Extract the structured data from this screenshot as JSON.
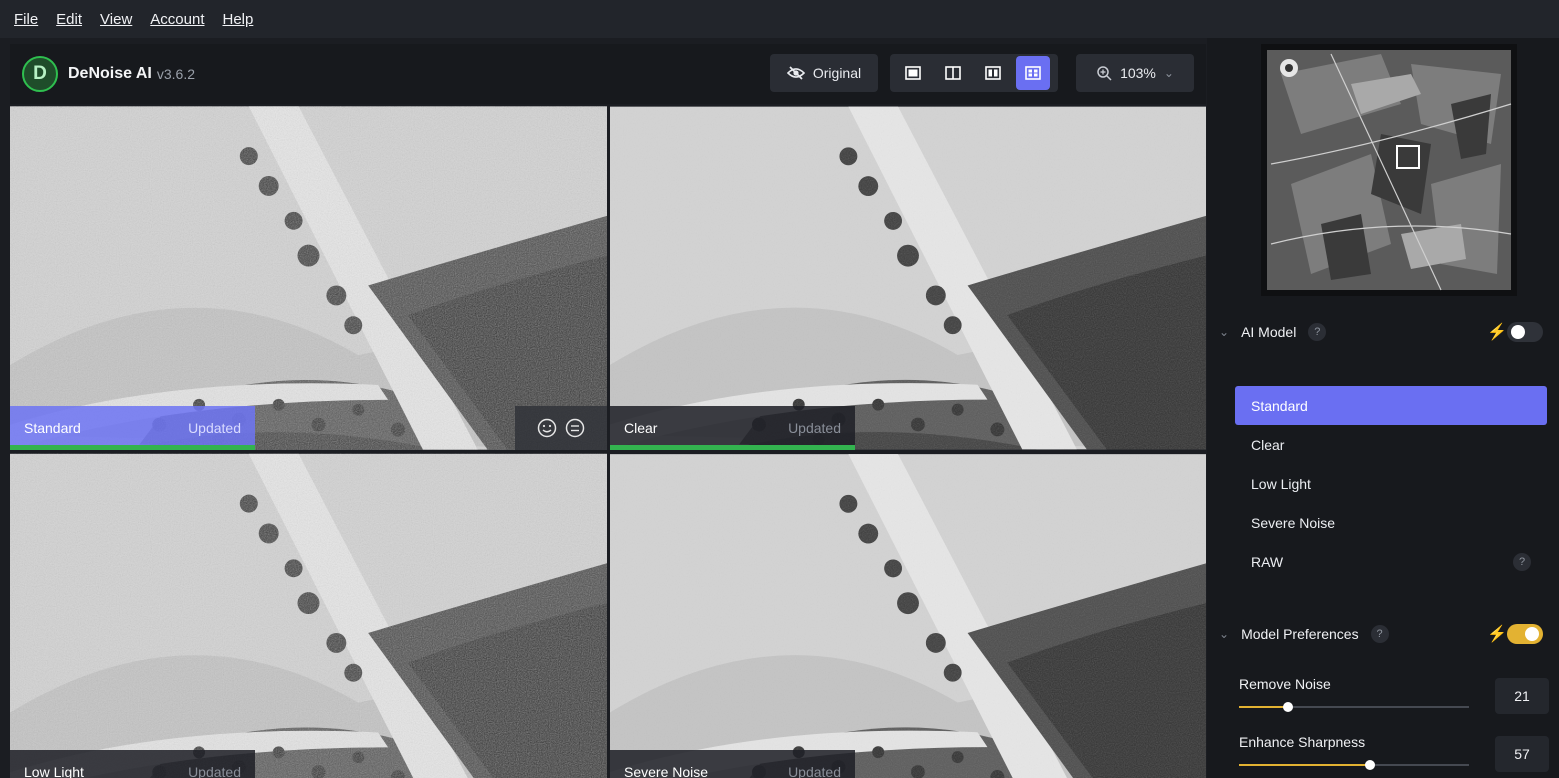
{
  "menu": [
    "File",
    "Edit",
    "View",
    "Account",
    "Help"
  ],
  "app": {
    "name": "DeNoise AI",
    "version": "v3.6.2",
    "logo_letter": "D"
  },
  "toolbar": {
    "original_label": "Original",
    "view_modes": [
      "single-view",
      "split-view",
      "side-by-side-view",
      "comparison-grid-view"
    ],
    "active_view": "comparison-grid-view",
    "zoom": "103%"
  },
  "panes": [
    {
      "name": "Standard",
      "status": "Updated",
      "selected": true,
      "progress": 1.0
    },
    {
      "name": "Clear",
      "status": "Updated",
      "selected": false,
      "progress": 1.0
    },
    {
      "name": "Low Light",
      "status": "Updated",
      "selected": false,
      "progress": 0
    },
    {
      "name": "Severe Noise",
      "status": "Updated",
      "selected": false,
      "progress": 0
    }
  ],
  "sidebar": {
    "ai_model": {
      "title": "AI Model",
      "help": "?",
      "auto_enabled": false,
      "items": [
        {
          "label": "Standard",
          "selected": true
        },
        {
          "label": "Clear",
          "selected": false
        },
        {
          "label": "Low Light",
          "selected": false
        },
        {
          "label": "Severe Noise",
          "selected": false
        },
        {
          "label": "RAW",
          "selected": false,
          "help": "?"
        }
      ]
    },
    "model_preferences": {
      "title": "Model Preferences",
      "help": "?",
      "auto_enabled": true,
      "remove_noise": {
        "label": "Remove Noise",
        "value": "21",
        "fraction": 0.21
      },
      "enhance_sharpness": {
        "label": "Enhance Sharpness",
        "value": "57",
        "fraction": 0.57
      }
    }
  },
  "colors": {
    "accent": "#6a6ff2",
    "progress": "#33b34f",
    "auto_toggle": "#e3b232",
    "panel_bg": "#17191d"
  },
  "icons": [
    "eye-slash-icon",
    "zoom-in-icon",
    "chevron-down-icon",
    "smile-face-icon",
    "neutral-face-icon",
    "bolt-icon",
    "help-icon"
  ]
}
